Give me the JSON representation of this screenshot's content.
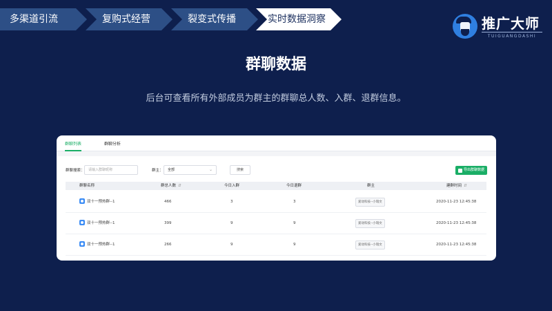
{
  "steps": [
    {
      "label": "多渠道引流",
      "active": false
    },
    {
      "label": "复购式经营",
      "active": false
    },
    {
      "label": "裂变式传播",
      "active": false
    },
    {
      "label": "实时数据洞察",
      "active": true
    }
  ],
  "logo": {
    "title": "推广大师",
    "subtitle": "TUIGUANGDASHI"
  },
  "headline": "群聊数据",
  "subline": "后台可查看所有外部成员为群主的群聊总人数、入群、退群信息。",
  "panel": {
    "tabs": [
      {
        "label": "群聊列表",
        "active": true
      },
      {
        "label": "群聊分析",
        "active": false
      }
    ],
    "filters": {
      "search_label": "群聊搜索：",
      "search_placeholder": "请输入群聊昵称",
      "owner_label": "群主：",
      "owner_value": "全部",
      "search_button": "搜索",
      "export_button": "导出群聊数据"
    },
    "table": {
      "columns": [
        "群聊名称",
        "群总人数",
        "今日入群",
        "今日退群",
        "群主",
        "建群时间"
      ],
      "rows": [
        {
          "name": "双十一预热群--1",
          "total": "466",
          "joined": "3",
          "left": "3",
          "owner": "爱动科技--小瑞文",
          "created": "2020-11-23 12:45:38"
        },
        {
          "name": "双十一预热群--1",
          "total": "399",
          "joined": "9",
          "left": "9",
          "owner": "爱动科技--小瑞文",
          "created": "2020-11-23 12:45:38"
        },
        {
          "name": "双十一预热群--1",
          "total": "266",
          "joined": "9",
          "left": "9",
          "owner": "爱动科技--小瑞文",
          "created": "2020-11-23 12:45:38"
        }
      ]
    }
  }
}
